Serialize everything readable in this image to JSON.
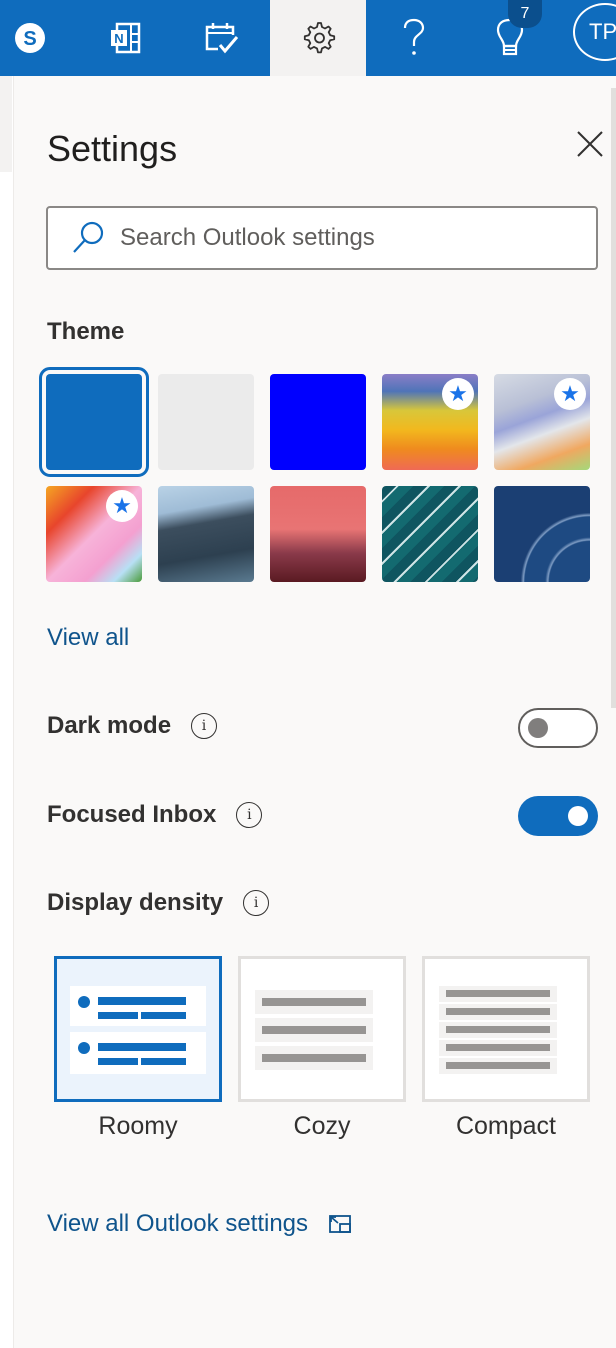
{
  "topbar": {
    "buttons": [
      {
        "name": "skype",
        "label": "Skype"
      },
      {
        "name": "onenote",
        "label": "OneNote"
      },
      {
        "name": "my-day",
        "label": "My Day"
      },
      {
        "name": "settings",
        "label": "Settings",
        "active": true
      },
      {
        "name": "help",
        "label": "Help"
      },
      {
        "name": "tips",
        "label": "Tips"
      }
    ],
    "tips_badge_count": "7",
    "avatar_initials": "TP",
    "colors": {
      "bar": "#0f6cbd",
      "active_bg": "#f3f2f1"
    }
  },
  "settings_panel": {
    "title": "Settings",
    "close_label": "Close",
    "search": {
      "placeholder": "Search Outlook settings",
      "value": ""
    },
    "theme": {
      "label": "Theme",
      "swatches": [
        {
          "name": "blue",
          "color": "#0f6cbd",
          "selected": true,
          "premium": false
        },
        {
          "name": "light-gray",
          "color": "#ebebeb",
          "selected": false,
          "premium": false
        },
        {
          "name": "bright-blue",
          "color": "#0000ff",
          "selected": false,
          "premium": false
        },
        {
          "name": "rainbow-stripes",
          "selected": false,
          "premium": true
        },
        {
          "name": "ribbons",
          "selected": false,
          "premium": true
        },
        {
          "name": "unicorn",
          "selected": false,
          "premium": true
        },
        {
          "name": "mountain-coast",
          "selected": false,
          "premium": false
        },
        {
          "name": "palm-sunset",
          "selected": false,
          "premium": false
        },
        {
          "name": "circuit",
          "selected": false,
          "premium": false
        },
        {
          "name": "blueprint",
          "selected": false,
          "premium": false
        }
      ],
      "premium_icon": "★",
      "view_all_label": "View all"
    },
    "dark_mode": {
      "label": "Dark mode",
      "enabled": false
    },
    "focused_inbox": {
      "label": "Focused Inbox",
      "enabled": true
    },
    "display_density": {
      "label": "Display density",
      "options": [
        {
          "label": "Roomy",
          "selected": true
        },
        {
          "label": "Cozy",
          "selected": false
        },
        {
          "label": "Compact",
          "selected": false
        }
      ]
    },
    "info_icon": "i",
    "view_all_settings_label": "View all Outlook settings"
  }
}
